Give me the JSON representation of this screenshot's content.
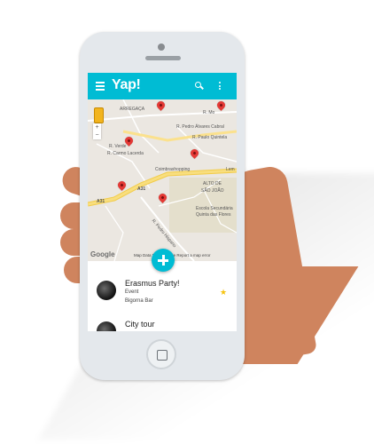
{
  "app": {
    "title": "Yap!"
  },
  "map": {
    "labels": {
      "arregaca": "ARREGAÇA",
      "pedro_alvares": "R. Pedro Álvares Cabral",
      "quintela": "R. Paulo Quintela",
      "verde": "R. Verde",
      "carmo": "R. Carmo Lacerda",
      "coimbrashopping": "Coimbrashopping",
      "lem": "Lem",
      "alto": "ALTO DE",
      "sao_joao": "SÃO JOÃO",
      "escola": "Escola Secundária",
      "quinta": "Quinta das Flores",
      "pedro_hispano": "R. Pedro Hispano",
      "a31a": "A31",
      "a31b": "A31",
      "rmo": "R. Mo"
    },
    "google": "Google",
    "footer": "Map Data  Terms of Use  Report a map error"
  },
  "events": [
    {
      "title": "Erasmus Party!",
      "type": "Event",
      "location": "Bigorna Bar",
      "starred": true
    },
    {
      "title": "City tour"
    }
  ],
  "colors": {
    "primary": "#00bcd4",
    "marker": "#e53935",
    "star": "#f6c30d",
    "skin": "#cf845e"
  },
  "icons": {
    "menu": "menu-icon",
    "search": "search-icon",
    "more": "more-vert-icon",
    "add": "add-icon",
    "star": "star-icon"
  }
}
